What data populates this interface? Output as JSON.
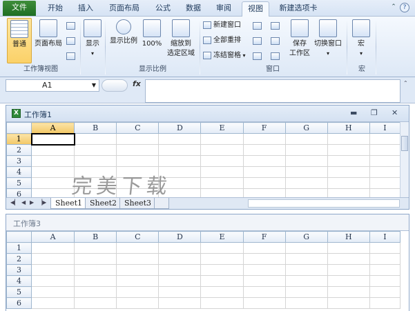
{
  "ribbon_tabs": [
    {
      "label": "文件"
    },
    {
      "label": "开始"
    },
    {
      "label": "插入"
    },
    {
      "label": "页面布局"
    },
    {
      "label": "公式"
    },
    {
      "label": "数据"
    },
    {
      "label": "审阅"
    },
    {
      "label": "视图"
    },
    {
      "label": "新建选项卡"
    }
  ],
  "active_tab": "视图",
  "groups": {
    "workbook_views": {
      "label": "工作簿视图",
      "normal": "普通",
      "page_layout": "页面布局"
    },
    "show": {
      "label": "显示"
    },
    "zoom": {
      "label": "显示比例",
      "zoom_btn": "显示比例",
      "hundred": "100%",
      "zoom_sel_1": "缩放到",
      "zoom_sel_2": "选定区域"
    },
    "window": {
      "label": "窗口",
      "new_window": "新建窗口",
      "arrange_all": "全部重排",
      "freeze_panes": "冻结窗格",
      "save_ws": "保存",
      "save_ws_2": "工作区",
      "switch_windows": "切换窗口"
    },
    "macros": {
      "label": "宏",
      "btn": "宏"
    }
  },
  "formula_bar": {
    "name_box": "A1",
    "fx": "fx",
    "formula": ""
  },
  "workbook1": {
    "title": "工作簿1",
    "columns": [
      "A",
      "B",
      "C",
      "D",
      "E",
      "F",
      "G",
      "H",
      "I"
    ],
    "rows": [
      "1",
      "2",
      "3",
      "4",
      "5",
      "6"
    ],
    "sheets": [
      "Sheet1",
      "Sheet2",
      "Sheet3"
    ],
    "active_sheet": "Sheet1"
  },
  "workbook3": {
    "title": "工作簿3",
    "columns": [
      "A",
      "B",
      "C",
      "D",
      "E",
      "F",
      "G",
      "H",
      "I"
    ],
    "rows": [
      "1",
      "2",
      "3",
      "4",
      "5",
      "6"
    ]
  },
  "watermark": "完美下载",
  "colors": {
    "file_tab": "#2a7a2d",
    "selected_button": "#fbd168",
    "ribbon_bg": "#dde8f6"
  }
}
